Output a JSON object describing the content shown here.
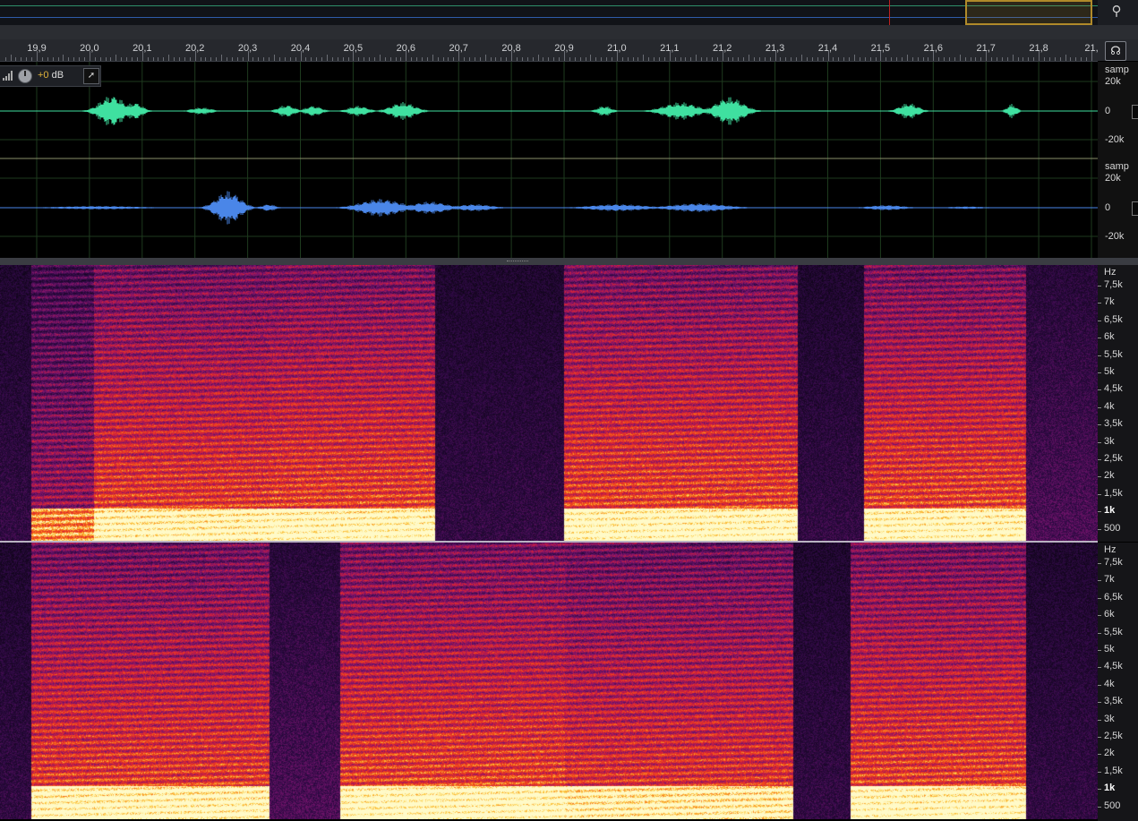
{
  "overview": {
    "zoom_icon": "zoom-magnifier-icon"
  },
  "ruler": {
    "labels": [
      "19,9",
      "20,0",
      "20,1",
      "20,2",
      "20,3",
      "20,4",
      "20,5",
      "20,6",
      "20,7",
      "20,8",
      "20,9",
      "21,0",
      "21,1",
      "21,2",
      "21,3",
      "21,4",
      "21,5",
      "21,6",
      "21,7",
      "21,8",
      "21,"
    ],
    "headphones_icon": "headphones-icon"
  },
  "track": {
    "gain_prefix": "+0",
    "gain_unit": "dB"
  },
  "wave_scale": {
    "ch1": [
      "samp",
      "20k",
      "0",
      "-20k"
    ],
    "ch2": [
      "samp",
      "20k",
      "0",
      "-20k"
    ]
  },
  "spectrum_scale": {
    "unit": "Hz",
    "labels": [
      "7,5k",
      "7k",
      "6,5k",
      "6k",
      "5,5k",
      "5k",
      "4,5k",
      "4k",
      "3,5k",
      "3k",
      "2,5k",
      "2k",
      "1,5k",
      "1k",
      "500"
    ]
  },
  "colors": {
    "wave_ch1": "#3fe0a0",
    "wave_ch2": "#4a86e8",
    "grid": "#1e3a1e",
    "accent": "#e0b23a"
  }
}
